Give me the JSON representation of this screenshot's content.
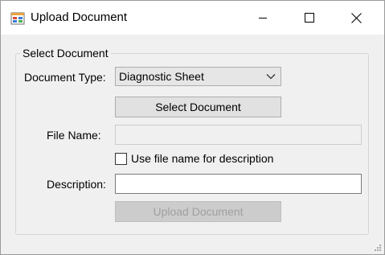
{
  "window": {
    "title": "Upload Document",
    "app_icon": "app-form-icon",
    "controls": {
      "minimize": "minimize-icon",
      "maximize": "maximize-icon",
      "close": "close-icon"
    }
  },
  "group": {
    "label": "Select Document"
  },
  "form": {
    "document_type_label": "Document Type:",
    "document_type_value": "Diagnostic Sheet",
    "select_document_label": "Select Document",
    "file_name_label": "File Name:",
    "file_name_value": "",
    "use_file_name_label": "Use file name for description",
    "use_file_name_checked": false,
    "description_label": "Description:",
    "description_value": "",
    "upload_label": "Upload Document",
    "upload_enabled": false
  },
  "colors": {
    "title_bar": "#ffffff",
    "window_bg": "#f0f0f0",
    "disabled_text": "#a0a0a0"
  }
}
